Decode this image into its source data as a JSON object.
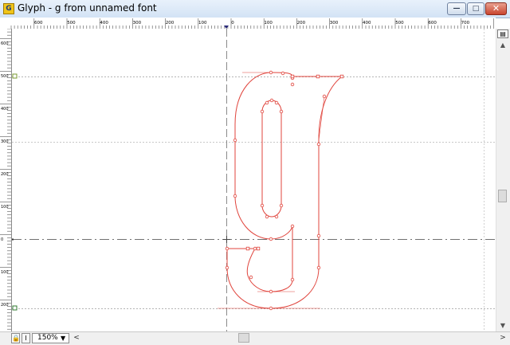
{
  "window": {
    "title": "Glyph - g from unnamed font",
    "app_icon_letter": "G",
    "minimize_glyph": "—",
    "maximize_glyph": "□",
    "close_glyph": "✕"
  },
  "rulers": {
    "horizontal_labels": [
      "600",
      "500",
      "400",
      "300",
      "200",
      "100",
      "0",
      "100",
      "200",
      "300",
      "400",
      "500",
      "600",
      "700"
    ],
    "vertical_labels": [
      "600",
      "500",
      "400",
      "300",
      "200",
      "100",
      "0",
      "100",
      "200",
      "300"
    ]
  },
  "statusbar": {
    "lock_glyph": "🔒",
    "info_glyph": "I",
    "zoom": "150%",
    "zoom_arrow": "▼",
    "scroll_left": "<",
    "scroll_right": ">"
  },
  "scrollbar": {
    "layers_glyph": "▤",
    "up": "▲",
    "down": "▼"
  },
  "colors": {
    "glyph_outline": "#e0443c",
    "guide_line": "#b4b4b4",
    "baseline": "#707070",
    "node_fill": "#ffffff"
  }
}
